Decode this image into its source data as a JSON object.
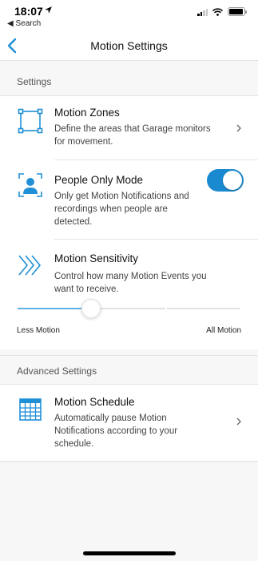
{
  "status_bar": {
    "time": "18:07",
    "back_to_app": "◀ Search",
    "battery_level": 0.92
  },
  "nav": {
    "title": "Motion Settings"
  },
  "sections": {
    "settings": "Settings",
    "advanced": "Advanced Settings"
  },
  "rows": {
    "motion_zones": {
      "title": "Motion Zones",
      "desc": "Define the areas that Garage monitors for movement."
    },
    "people_only": {
      "title": "People Only Mode",
      "desc": "Only get Motion Notifications and recordings when people are detected.",
      "enabled": true
    },
    "sensitivity": {
      "title": "Motion Sensitivity",
      "desc": "Control how many Motion Events you want to receive.",
      "value": 0.33,
      "min_label": "Less Motion",
      "max_label": "All Motion"
    },
    "schedule": {
      "title": "Motion Schedule",
      "desc": "Automatically pause Motion Notifications according to your schedule."
    }
  },
  "colors": {
    "accent": "#1a8ad0",
    "icon": "#1f8fd6",
    "slider_fill": "#5fb2e2"
  },
  "icons": {
    "back": "chevron-left-icon",
    "motion_zones": "motion-zones-icon",
    "people_only": "person-frame-icon",
    "sensitivity": "chevrons-right-icon",
    "schedule": "calendar-icon",
    "chevron": "chevron-right-icon"
  }
}
